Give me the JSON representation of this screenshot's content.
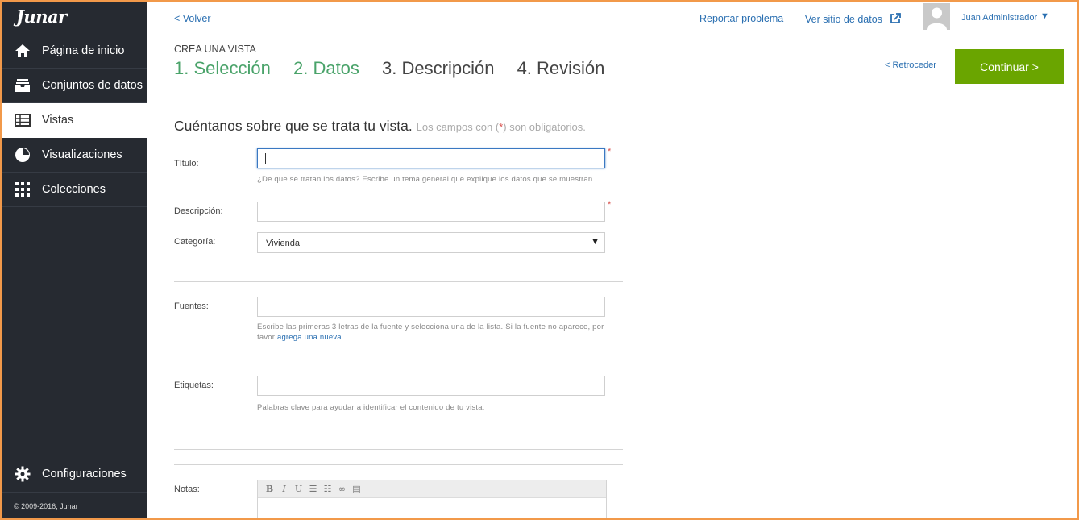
{
  "sidebar": {
    "logo": "Junar",
    "items": [
      {
        "label": "Página de inicio",
        "icon": "home-icon"
      },
      {
        "label": "Conjuntos de datos",
        "icon": "inbox-icon"
      },
      {
        "label": "Vistas",
        "icon": "table-icon",
        "active": true
      },
      {
        "label": "Visualizaciones",
        "icon": "pie-chart-icon"
      },
      {
        "label": "Colecciones",
        "icon": "grid-icon"
      }
    ],
    "settings_label": "Configuraciones",
    "copyright": "© 2009-2016, Junar"
  },
  "topbar": {
    "back": "< Volver",
    "report": "Reportar problema",
    "view_site": "Ver sitio de datos",
    "user": "Juan Administrador"
  },
  "wizard": {
    "crumb": "CREA UNA VISTA",
    "steps": [
      "1. Selección",
      "2. Datos",
      "3. Descripción",
      "4. Revisión"
    ],
    "back_label": "< Retroceder",
    "continue_label": "Continuar >"
  },
  "form": {
    "heading": "Cuéntanos sobre que se trata tu vista.",
    "sub_prefix": "Los campos con (",
    "sub_star": "*",
    "sub_suffix": ") son obligatorios.",
    "required_mark": "*",
    "title_label": "Título:",
    "title_value": "",
    "title_help": "¿De que se tratan los datos? Escribe un tema general que explique los datos que se muestran.",
    "desc_label": "Descripción:",
    "desc_value": "",
    "category_label": "Categoría:",
    "category_value": "Vivienda",
    "sources_label": "Fuentes:",
    "sources_value": "",
    "sources_help_1": "Escribe las primeras 3 letras de la fuente y selecciona una de la lista. Si la fuente no aparece, por",
    "sources_help_2": "favor ",
    "sources_help_link": "agrega una nueva",
    "sources_help_end": ".",
    "tags_label": "Etiquetas:",
    "tags_value": "",
    "tags_help": "Palabras clave para ayudar a identificar el contenido de tu vista.",
    "notes_label": "Notas:"
  },
  "colors": {
    "sidebar_bg": "#262a31",
    "accent_green": "#6aa500",
    "step_done": "#4aa36a",
    "link": "#2a6fb1",
    "frame": "#f2994a"
  }
}
